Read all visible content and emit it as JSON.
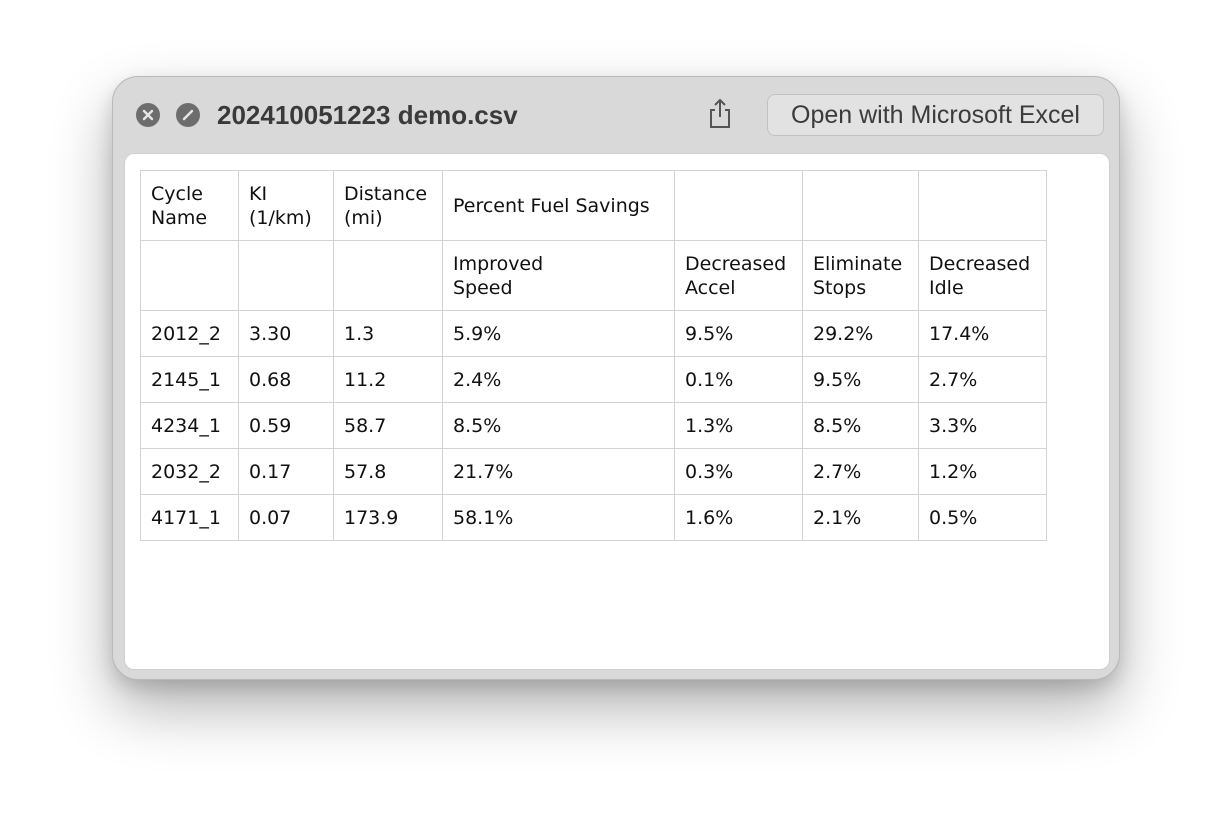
{
  "window": {
    "title": "202410051223 demo.csv",
    "open_button_label": "Open with Microsoft Excel"
  },
  "icons": {
    "close": "close-icon",
    "fullscreen": "fullscreen-icon",
    "share": "share-icon"
  },
  "colors": {
    "window_bg": "#d9d9d9",
    "grid_border": "#d3d3d3"
  },
  "table": {
    "header_row_1": [
      "Cycle\nName",
      "KI\n(1/km)",
      "Distance\n(mi)",
      "Percent Fuel Savings",
      "",
      "",
      ""
    ],
    "header_row_2": [
      "",
      "",
      "",
      "Improved\nSpeed",
      "Decreased\nAccel",
      "Eliminate\nStops",
      "Decreased\nIdle"
    ],
    "rows": [
      [
        "2012_2",
        "3.30",
        "1.3",
        "5.9%",
        "9.5%",
        "29.2%",
        "17.4%"
      ],
      [
        "2145_1",
        "0.68",
        "11.2",
        "2.4%",
        "0.1%",
        "9.5%",
        "2.7%"
      ],
      [
        "4234_1",
        "0.59",
        "58.7",
        "8.5%",
        "1.3%",
        "8.5%",
        "3.3%"
      ],
      [
        "2032_2",
        "0.17",
        "57.8",
        "21.7%",
        "0.3%",
        "2.7%",
        "1.2%"
      ],
      [
        "4171_1",
        "0.07",
        "173.9",
        "58.1%",
        "1.6%",
        "2.1%",
        "0.5%"
      ]
    ]
  }
}
